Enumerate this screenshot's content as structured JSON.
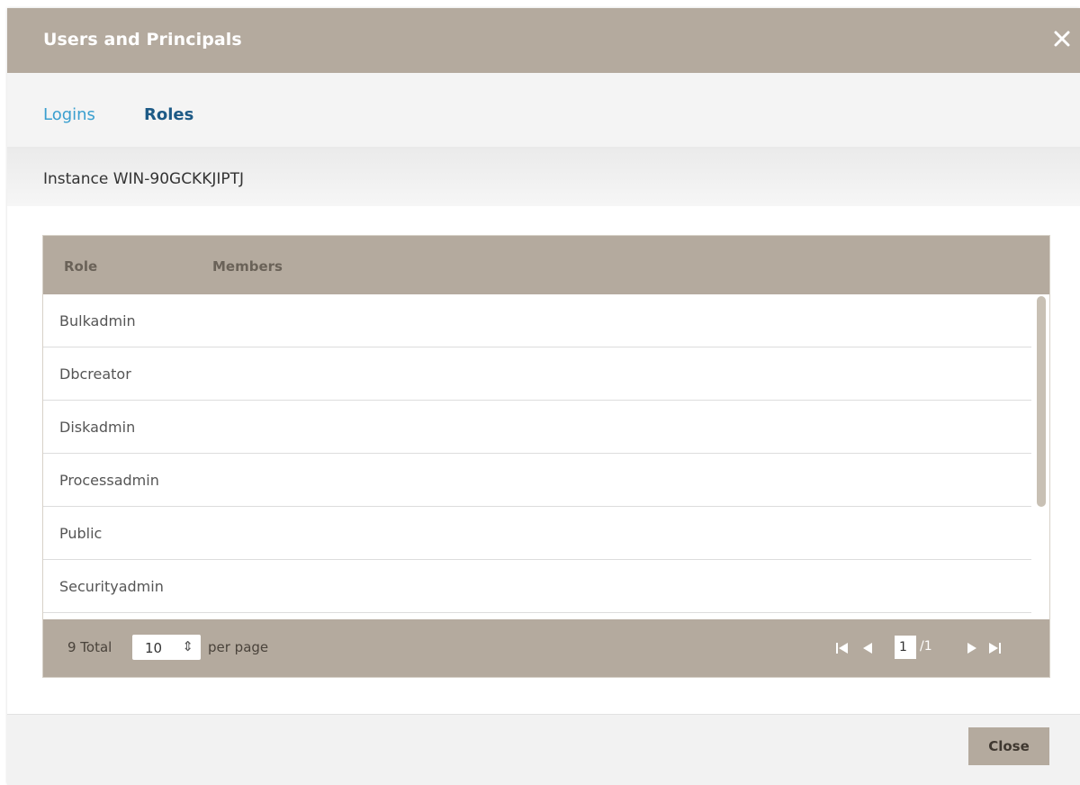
{
  "dialog": {
    "title": "Users and Principals",
    "close_icon_label": "close"
  },
  "tabs": [
    {
      "label": "Logins",
      "active": false
    },
    {
      "label": "Roles",
      "active": true
    }
  ],
  "instance_label": "Instance WIN-90GCKKJIPTJ",
  "grid": {
    "columns": [
      "Role",
      "Members"
    ],
    "rows": [
      {
        "role": "Bulkadmin",
        "members": ""
      },
      {
        "role": "Dbcreator",
        "members": ""
      },
      {
        "role": "Diskadmin",
        "members": ""
      },
      {
        "role": "Processadmin",
        "members": ""
      },
      {
        "role": "Public",
        "members": ""
      },
      {
        "role": "Securityadmin",
        "members": ""
      }
    ]
  },
  "pager": {
    "total": "9 Total",
    "page_size": "10",
    "per_page_label": "per page",
    "current_page": "1",
    "page_count": "/1"
  },
  "footer": {
    "close_label": "Close"
  },
  "colors": {
    "header_bg": "#b4aa9e",
    "link_blue": "#3a9fcf",
    "active_tab": "#1d5a86"
  }
}
